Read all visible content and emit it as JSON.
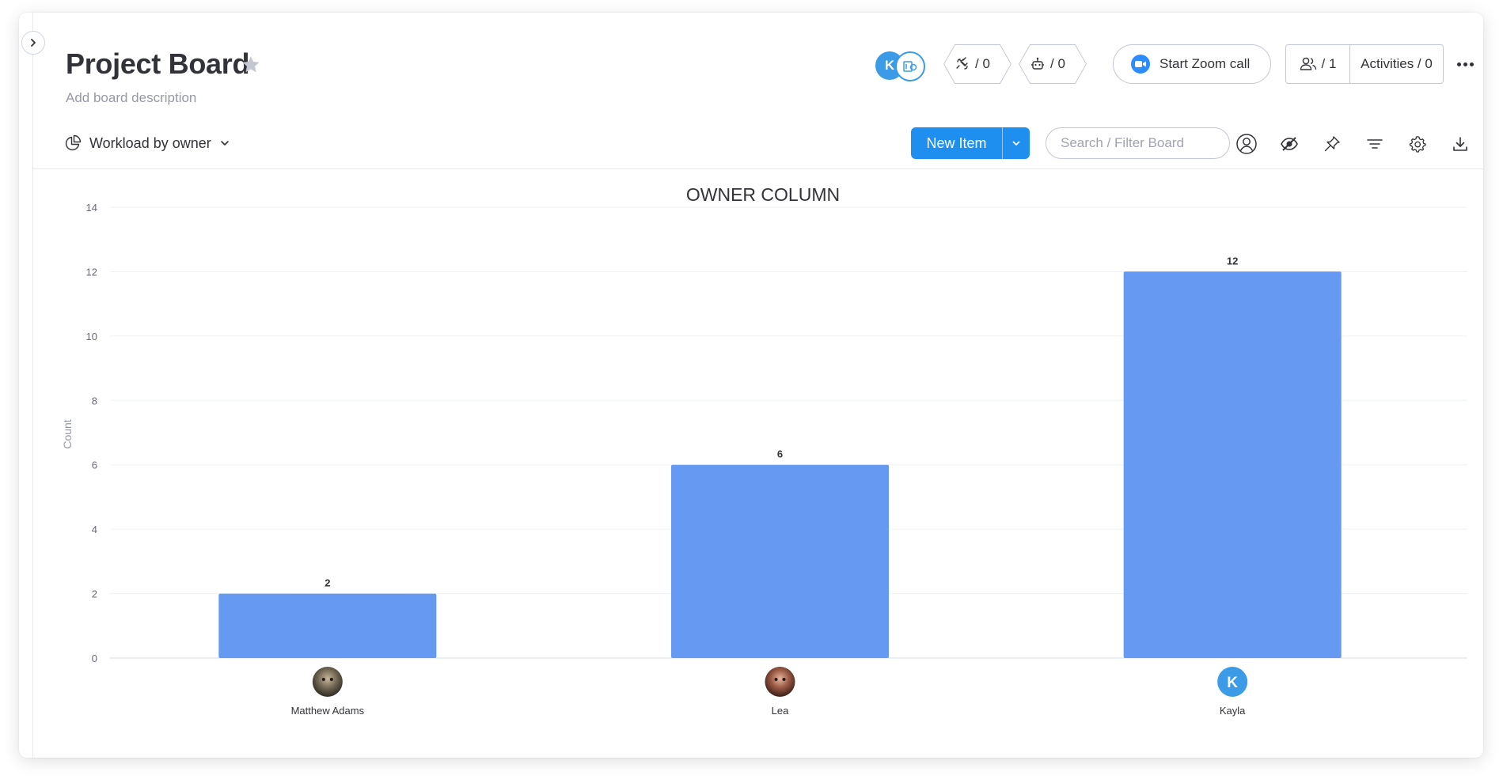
{
  "board": {
    "title": "Project Board",
    "description_placeholder": "Add board description"
  },
  "header": {
    "avatars": [
      "K"
    ],
    "updates_count": "/ 0",
    "automations_count": "/ 0",
    "zoom_label": "Start Zoom call",
    "people_count": "/ 1",
    "activities_label": "Activities / 0",
    "icons": [
      "chevron-right-icon",
      "star-icon",
      "guest-icon",
      "integration-icon",
      "robot-icon",
      "zoom-icon",
      "people-icon",
      "more-icon"
    ]
  },
  "toolbar": {
    "view_label": "Workload by owner",
    "new_item_label": "New Item",
    "search_placeholder": "Search / Filter Board",
    "icons": [
      "pie-chart-icon",
      "chevron-down-icon",
      "person-filter-icon",
      "hide-icon",
      "pin-icon",
      "filter-icon",
      "settings-icon",
      "download-icon"
    ]
  },
  "colors": {
    "accent": "#1f8fef",
    "bar": "#6599f2",
    "avatar_k": "#3b9be7"
  },
  "chart_data": {
    "type": "bar",
    "title": "OWNER COLUMN",
    "ylabel": "Count",
    "xlabel": "",
    "ylim": [
      0,
      14
    ],
    "yticks": [
      "0",
      "2",
      "4",
      "6",
      "8",
      "10",
      "12",
      "14"
    ],
    "grid": true,
    "categories": [
      "Matthew Adams",
      "Lea",
      "Kayla"
    ],
    "values": [
      2,
      6,
      12
    ],
    "value_labels": [
      "2",
      "6",
      "12"
    ],
    "owner_avatars": [
      "photo",
      "photo",
      "K"
    ]
  }
}
